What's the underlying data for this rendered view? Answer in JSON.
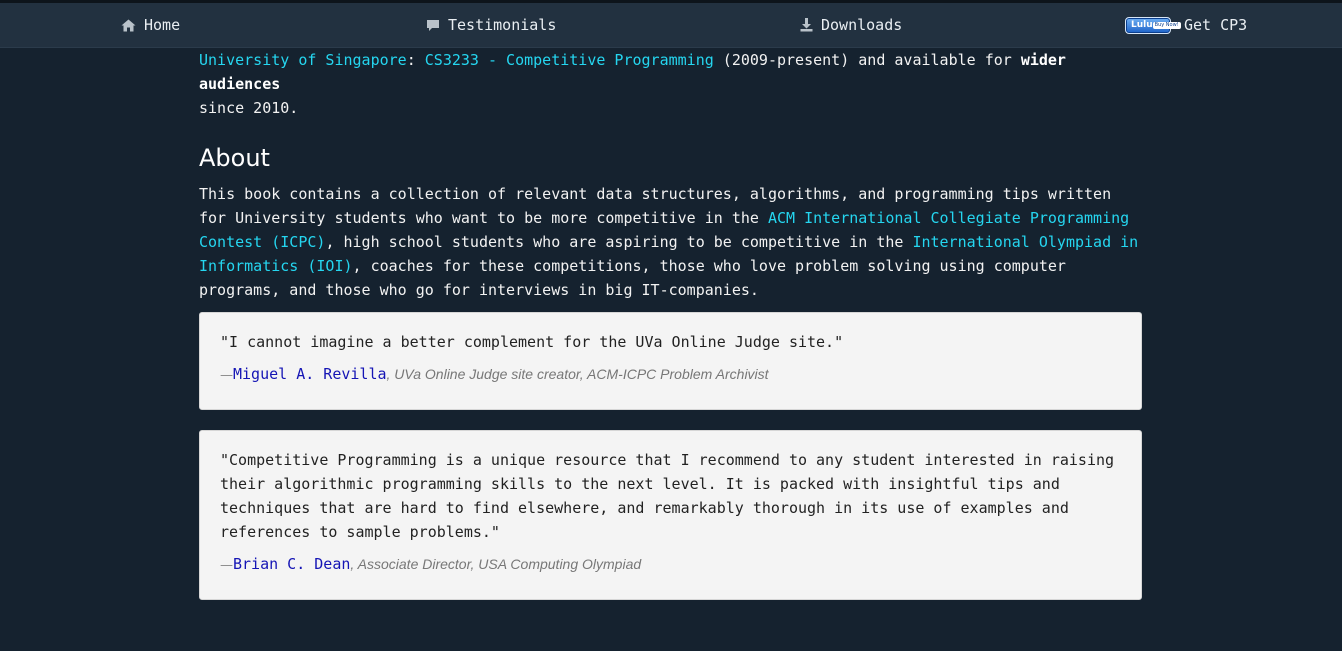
{
  "nav": {
    "home": "Home",
    "testimonials": "Testimonials",
    "downloads": "Downloads",
    "lulu_logo": "Lulu",
    "lulu_buy": "Buy Now!",
    "get_cp3": "Get CP3",
    "icons": [
      "home-icon",
      "comment-icon",
      "download-icon",
      "lulu-buy-now-badge"
    ]
  },
  "intro": {
    "link_nus": "University of Singapore",
    "colon": ": ",
    "link_course": "CS3233 - Competitive Programming",
    "text_1": " (2009-present) and available for ",
    "bold": "wider audiences",
    "text_2": "since 2010."
  },
  "about": {
    "heading": "About",
    "text_1": "This book contains a collection of relevant data structures, algorithms, and programming tips written for University students who want to be more competitive in the ",
    "link_icpc": "ACM International Collegiate Programming Contest (ICPC)",
    "text_2": ", high school students who are aspiring to be competitive in the ",
    "link_ioi": "International Olympiad in Informatics (IOI)",
    "text_3": ", coaches for these competitions, those who love problem solving using computer programs, and those who go for interviews in big IT-companies."
  },
  "testimonials": [
    {
      "quote": "\"I cannot imagine a better complement for the UVa Online Judge site.\"",
      "dash": "—",
      "author": "Miguel A. Revilla",
      "role": ", UVa Online Judge site creator, ACM-ICPC Problem Archivist"
    },
    {
      "quote": "\"Competitive Programming is a unique resource that I recommend to any student interested in raising their algorithmic programming skills to the next level. It is packed with insightful tips and techniques that are hard to find elsewhere, and remarkably thorough in its use of examples and references to sample problems.\"",
      "dash": "—",
      "author": "Brian C. Dean",
      "role": ", Associate Director, USA Computing Olympiad"
    }
  ],
  "colors": {
    "background": "#15222f",
    "navbar": "#223140",
    "link": "#25d6f0",
    "quote_box": "#f4f4f4",
    "author_link": "#1515b5"
  }
}
